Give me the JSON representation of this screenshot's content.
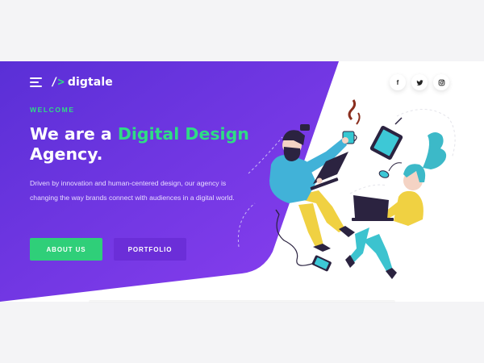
{
  "brand": {
    "mark_slash": "/",
    "mark_arrow": ">",
    "name": "digtale"
  },
  "nav": {
    "menu_icon": "hamburger-menu-icon",
    "social": [
      {
        "network": "facebook",
        "icon": "facebook-icon",
        "glyph": "f"
      },
      {
        "network": "twitter",
        "icon": "twitter-icon"
      },
      {
        "network": "instagram",
        "icon": "instagram-icon"
      }
    ]
  },
  "hero": {
    "eyebrow": "WELCOME",
    "headline_part1": "We are a ",
    "headline_accent": "Digital Design",
    "headline_part2": "Agency.",
    "description": "Driven by innovation and human-centered design, our agency is changing the way brands connect with audiences in a digital world.",
    "primary_button": "ABOUT US",
    "secondary_button": "PORTFOLIO"
  },
  "illustration": {
    "subject": "two-people-working-on-laptops"
  },
  "colors": {
    "purple_start": "#5a2fd6",
    "purple_end": "#8a3ff0",
    "accent_green": "#2fdc85",
    "button_green": "#2fcf79",
    "button_purple": "#6b2ed8",
    "page_bg": "#f4f4f6"
  }
}
